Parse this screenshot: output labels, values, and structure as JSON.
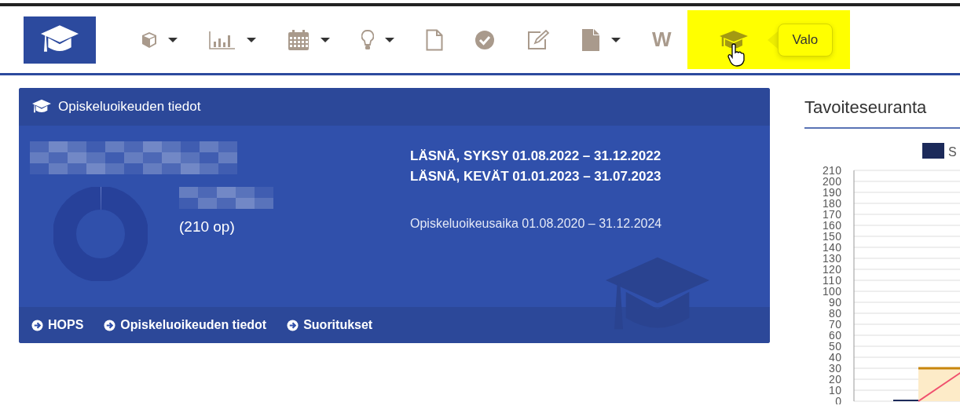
{
  "nav": {
    "items": [
      {
        "dropdown": true,
        "selected": false
      },
      {
        "dropdown": true,
        "selected": false
      },
      {
        "dropdown": true,
        "selected": false
      },
      {
        "dropdown": true,
        "selected": false
      },
      {
        "dropdown": false,
        "selected": false
      },
      {
        "dropdown": false,
        "selected": false
      },
      {
        "dropdown": false,
        "selected": false
      },
      {
        "dropdown": true,
        "selected": false
      },
      {
        "label": "W",
        "dropdown": false,
        "selected": false
      },
      {
        "dropdown": false,
        "selected": true,
        "tooltip": "Valo"
      }
    ]
  },
  "card": {
    "title": "Opiskeluoikeuden tiedot",
    "progress": {
      "level": 0
    },
    "credits": "(210 op)",
    "terms": [
      "LÄSNÄ, SYKSY 01.08.2022 – 31.12.2022",
      "LÄSNÄ, KEVÄT 01.01.2023 – 31.07.2023"
    ],
    "period": "Opiskeluoikeusaika 01.08.2020 – 31.12.2024",
    "links": [
      "HOPS",
      "Opiskeluoikeuden tiedot",
      "Suoritukset"
    ]
  },
  "goals": {
    "title": "Tavoiteseuranta",
    "chart_data": {
      "type": "bar",
      "grid": true,
      "ylim": [
        0,
        210
      ],
      "yticks": [
        0,
        10,
        20,
        30,
        40,
        50,
        60,
        70,
        80,
        90,
        100,
        110,
        120,
        130,
        140,
        150,
        160,
        170,
        180,
        190,
        200,
        210
      ],
      "series": [
        {
          "name": "S",
          "color": "#1c2a5a",
          "values": [
            0
          ]
        }
      ]
    }
  }
}
